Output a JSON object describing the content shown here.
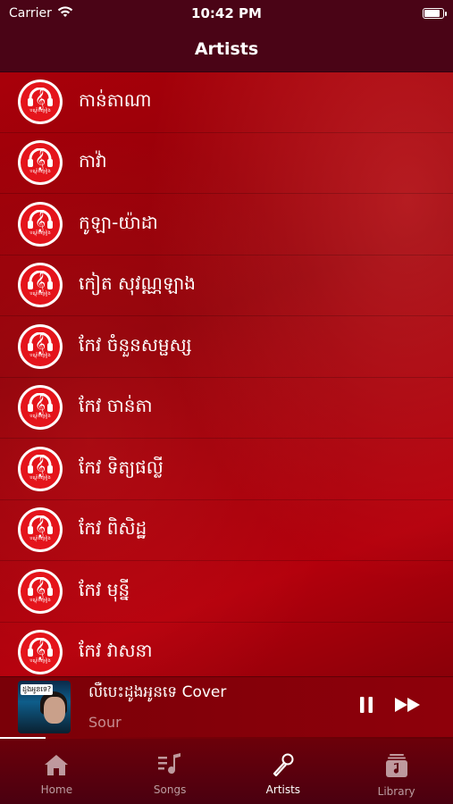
{
  "status_bar": {
    "carrier": "Carrier",
    "time": "10:42 PM"
  },
  "nav": {
    "title": "Artists"
  },
  "artist_logo_text": "បណ្តុំចម្រៀង",
  "artists": [
    {
      "name": "កាន់តាណា"
    },
    {
      "name": "កាវ៉ា"
    },
    {
      "name": "កូឡា-យ៉ាដា"
    },
    {
      "name": "កៀត សុវណ្ណឡាង"
    },
    {
      "name": "កែវ ចំនួនសម្ផស្ស"
    },
    {
      "name": "កែវ ចាន់តា"
    },
    {
      "name": "កែវ ទិត្យផល្លី"
    },
    {
      "name": "កែវ ពិសិដ្ឋ"
    },
    {
      "name": "កែវ មុន្នី"
    },
    {
      "name": "កែវ វាសនា"
    }
  ],
  "mini_player": {
    "title": "លឺបេះដូងអូនទេ Cover",
    "artist": "Sour",
    "cover_text": "ដូងអូនទេ?",
    "progress": 0.1
  },
  "tabs": [
    {
      "label": "Home",
      "icon": "home-icon"
    },
    {
      "label": "Songs",
      "icon": "songs-icon"
    },
    {
      "label": "Artists",
      "icon": "mic-icon",
      "active": true
    },
    {
      "label": "Library",
      "icon": "library-icon"
    }
  ],
  "colors": {
    "accent": "#e4141b",
    "nav_bg": "#4a0416",
    "bg": "#8a0008"
  }
}
